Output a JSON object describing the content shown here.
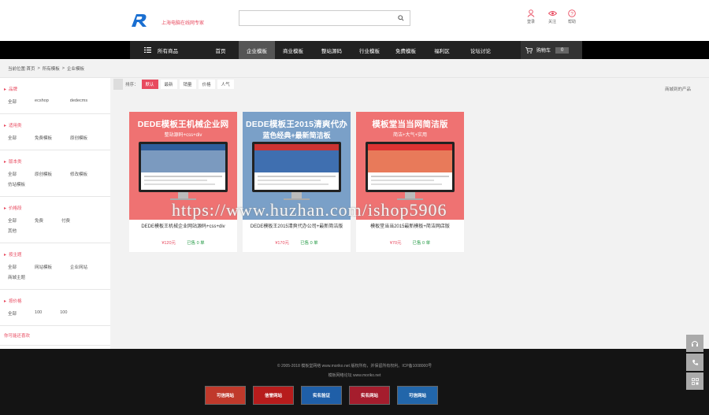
{
  "header": {
    "tagline": "上海电脑在线网专家",
    "search": {
      "placeholder": "",
      "value": ""
    },
    "links": [
      {
        "label": "登录",
        "icon": "user-icon"
      },
      {
        "label": "关注",
        "icon": "eye-icon"
      },
      {
        "label": "帮助",
        "icon": "help-icon"
      }
    ]
  },
  "nav": {
    "all_categories": "所有商品",
    "items": [
      "首页",
      "企业模板",
      "商业模板",
      "整站源码",
      "行业模板",
      "免费模板",
      "福利区",
      "论坛讨论"
    ],
    "active_index": 1,
    "cart_label": "购物车",
    "cart_count": "0"
  },
  "breadcrumb": {
    "items": [
      "当前位置:首页",
      ">",
      "所有模板",
      ">",
      "企业模板"
    ]
  },
  "sidebar": {
    "groups": [
      {
        "title": "品牌",
        "options": [
          "全部",
          "ecshop",
          "dedecms"
        ]
      },
      {
        "title": "适用类",
        "options": [
          "全部",
          "免费模板",
          "原创模板"
        ]
      },
      {
        "title": "版本类",
        "options": [
          "全部",
          "原创模板",
          "修改模板",
          "仿站模板"
        ]
      },
      {
        "title": "价格段",
        "options": [
          "全部",
          "免费",
          "付费",
          "其他"
        ]
      },
      {
        "title": "按主题",
        "options": [
          "全部",
          "网站模板",
          "企业网站",
          "商城主题"
        ]
      },
      {
        "title": "按价格",
        "options": [
          "全部",
          "100",
          "100"
        ]
      }
    ],
    "footer_link": "你可能还喜欢"
  },
  "sort": {
    "label": "排序：",
    "buttons": [
      "默认",
      "最新",
      "销量",
      "价格",
      "人气"
    ],
    "active_index": 0,
    "top_right": "商城到的产品"
  },
  "products": [
    {
      "thumb_title": "DEDE模板王机械企业网",
      "thumb_sub": "整站源码+css+div",
      "bg": "#ef7272",
      "title": "DEDE模板王机械企业网站源码+css+div",
      "price": "¥120元",
      "sold": "已售 0 单"
    },
    {
      "thumb_title": "DEDE模板王2015清爽代办",
      "thumb_sub": "蓝色经典+最新简洁板",
      "bg": "#7aa0c8",
      "title": "DEDE模板王2015清爽代办公司+最新简洁版",
      "price": "¥170元",
      "sold": "已售 0 单"
    },
    {
      "thumb_title": "模板堂当当网简洁版",
      "thumb_sub": "简洁+大气+实用",
      "bg": "#ef7272",
      "title": "模板堂当当2015最新模板+简洁网店版",
      "price": "¥70元",
      "sold": "已售 0 单"
    }
  ],
  "footer": {
    "line1": "© 2005-2018 模板堂网络 www.moriko.net 版权所有，并保留所有权利。ICP备1008000号",
    "line2": "模板网络论坛 www.moriko.net",
    "badges": [
      "可信网站",
      "信誉网站",
      "实名验证",
      "实名网站",
      "可信网站"
    ]
  },
  "watermark": "https://www.huzhan.com/ishop5906",
  "colors": {
    "accent": "#e84a5f",
    "nav_bg": "#000000",
    "footer_bg": "#141414",
    "price": "#e84a5f",
    "sold": "#2a9d4a"
  }
}
